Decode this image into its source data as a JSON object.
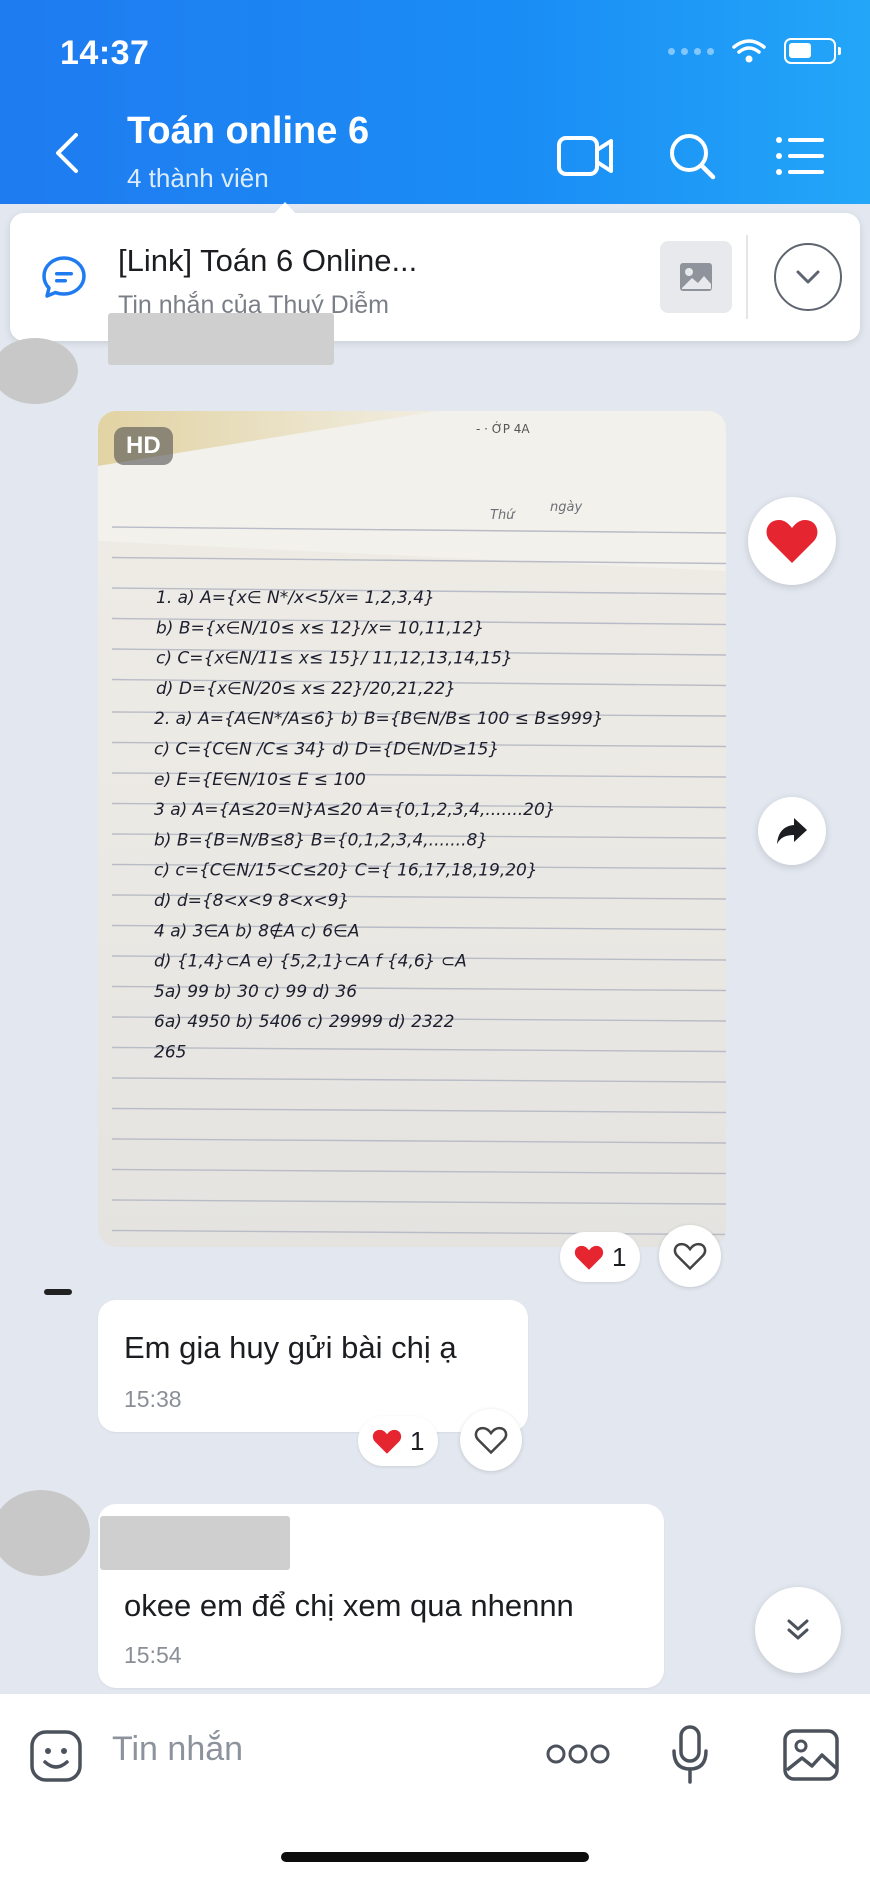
{
  "status_bar": {
    "time": "14:37"
  },
  "header": {
    "title": "Toán online 6",
    "subtitle": "4 thành viên"
  },
  "pinned": {
    "title": "[Link] Toán 6 Online...",
    "subtitle": "Tin nhắn của Thuý Diễm"
  },
  "image_message": {
    "badge": "HD",
    "notebook": {
      "header_day": "Thứ",
      "header_date": "ngày",
      "lines": [
        "1. a) A={x∈ N*/x<5/x= 1,2,3,4}",
        "b) B={x∈N/10≤ x≤ 12}/x= 10,11,12}",
        "c) C={x∈N/11≤ x≤ 15}/ 11,12,13,14,15}",
        "d) D={x∈N/20≤ x≤ 22}/20,21,22}",
        "2. a) A={A∈N*/A≤6}        b) B={B∈N/B≤ 100 ≤ B≤999}",
        "c) C={C∈N /C≤ 34}          d) D={D∈N/D≥15}",
        "e) E={E∈N/10≤ E ≤ 100",
        "3 a) A={A≤20=N}A≤20       A={0,1,2,3,4,.......20}",
        "b) B={B=N/B≤8}              B={0,1,2,3,4,.......8}",
        "c) c={C∈N/15<C≤20}        C={ 16,17,18,19,20}",
        "d) d={8<x<9 8<x<9}",
        "4 a) 3∈A      b) 8∉A        c) 6∈A",
        "d) {1,4}⊂A    e) {5,2,1}⊂A    f {4,6} ⊂A",
        "5a) 99      b) 30     c) 99     d) 36",
        "6a) 4950     b) 5406       c) 29999   d) 2322",
        "              265"
      ]
    },
    "reaction_count": "1"
  },
  "messages": [
    {
      "text": "Em gia huy gửi bài chị ạ",
      "time": "15:38",
      "reaction_count": "1"
    },
    {
      "text": "okee em để chị xem qua nhennn",
      "time": "15:54"
    }
  ],
  "composer": {
    "placeholder": "Tin nhắn"
  },
  "colors": {
    "header_start": "#1f7bf0",
    "header_end": "#23a6f8",
    "chat_background": "#e3e8f0",
    "heart": "#e5252f"
  },
  "icons": [
    "back-icon",
    "video-call-icon",
    "search-icon",
    "menu-icon",
    "chat-bubble-icon",
    "image-icon",
    "chevron-down-icon",
    "heart-icon",
    "share-icon",
    "sticker-icon",
    "more-icon",
    "microphone-icon",
    "gallery-icon"
  ]
}
